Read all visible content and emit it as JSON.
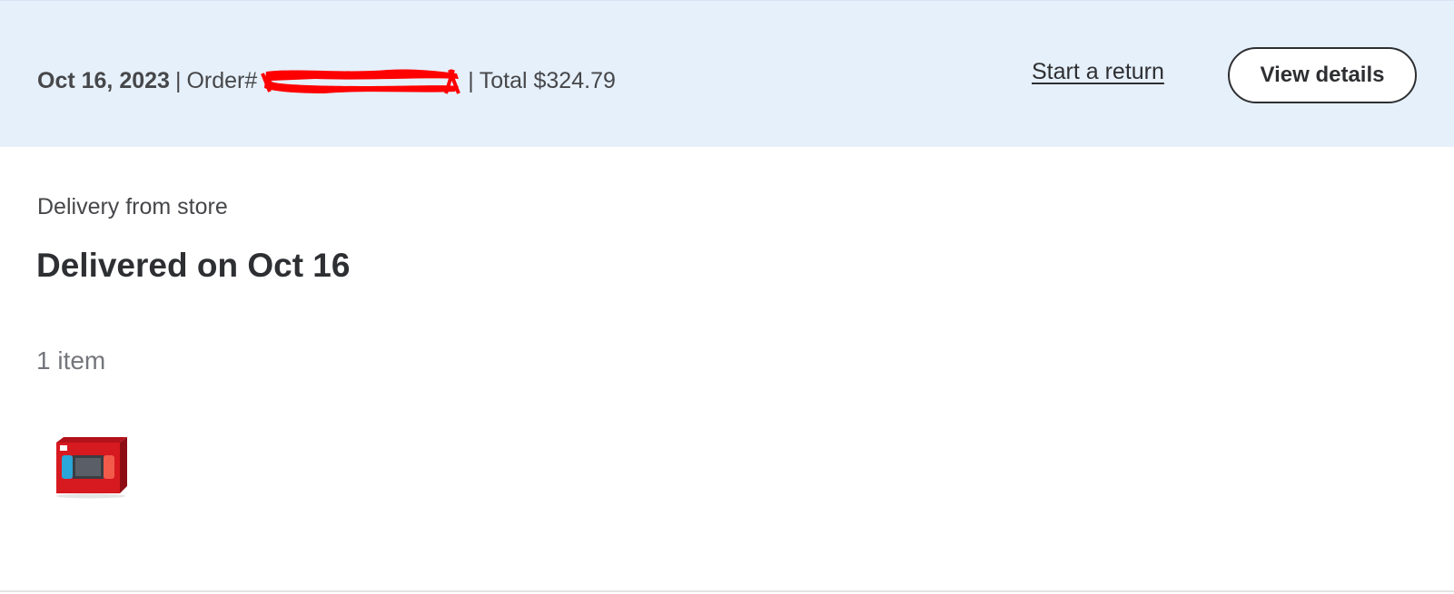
{
  "order": {
    "date": "Oct 16, 2023",
    "separator": "|",
    "order_label": "Order#",
    "total_label": "Total $324.79",
    "start_return_label": "Start a return",
    "view_details_label": "View details"
  },
  "shipment": {
    "fulfillment_type": "Delivery from store",
    "status": "Delivered on Oct 16",
    "item_count": "1 item",
    "items": [
      {
        "thumbnail_icon": "nintendo-switch-box-icon"
      }
    ]
  },
  "colors": {
    "header_background": "#e6f0fa",
    "redaction": "#ff0000",
    "text_primary": "#2e2f32",
    "text_secondary": "#74767c"
  }
}
